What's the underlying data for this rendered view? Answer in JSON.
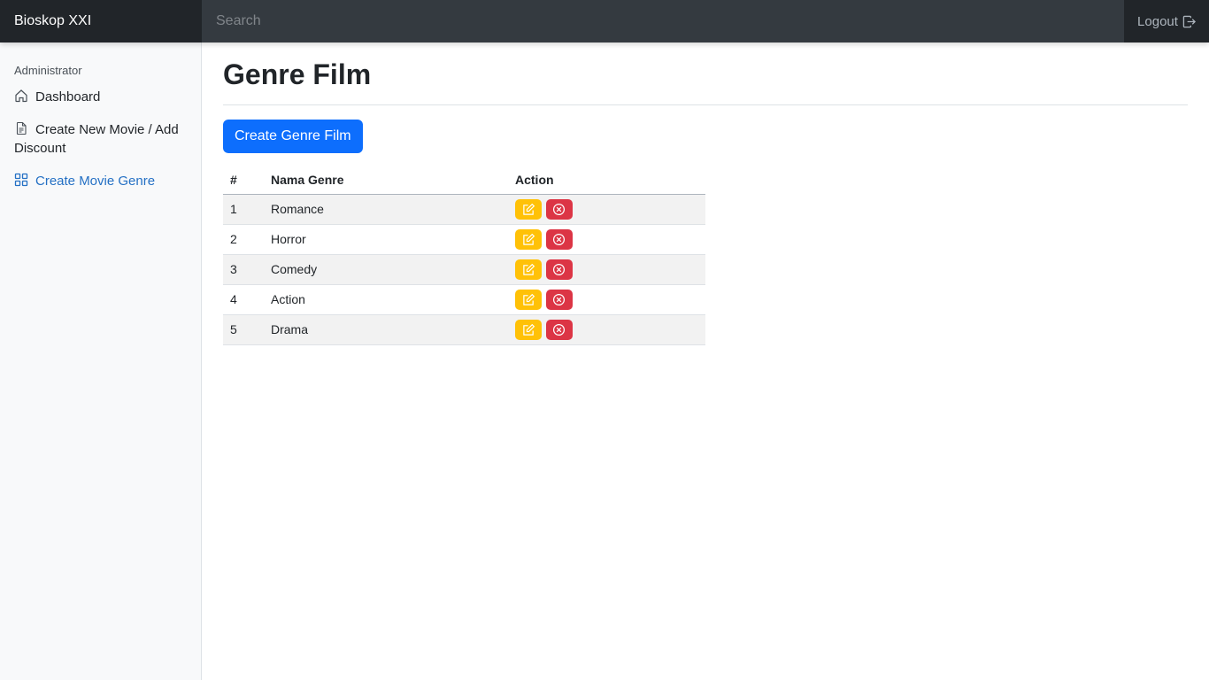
{
  "navbar": {
    "brand": "Bioskop XXI",
    "search_placeholder": "Search",
    "logout_label": "Logout"
  },
  "sidebar": {
    "heading": "Administrator",
    "items": [
      {
        "label": "Dashboard",
        "icon": "home-icon",
        "active": false
      },
      {
        "label": "Create New Movie / Add Discount",
        "icon": "file-icon",
        "active": false
      },
      {
        "label": "Create Movie Genre",
        "icon": "grid-icon",
        "active": true
      }
    ]
  },
  "main": {
    "title": "Genre Film",
    "create_button": "Create Genre Film",
    "table": {
      "headers": [
        "#",
        "Nama Genre",
        "Action"
      ],
      "rows": [
        {
          "num": "1",
          "name": "Romance"
        },
        {
          "num": "2",
          "name": "Horror"
        },
        {
          "num": "3",
          "name": "Comedy"
        },
        {
          "num": "4",
          "name": "Action"
        },
        {
          "num": "5",
          "name": "Drama"
        }
      ]
    }
  },
  "colors": {
    "navbar_bg": "#343a40",
    "brand_bg": "#212529",
    "primary": "#0d6efd",
    "edit": "#ffc107",
    "delete": "#dc3545",
    "active_link": "#2470c4"
  }
}
